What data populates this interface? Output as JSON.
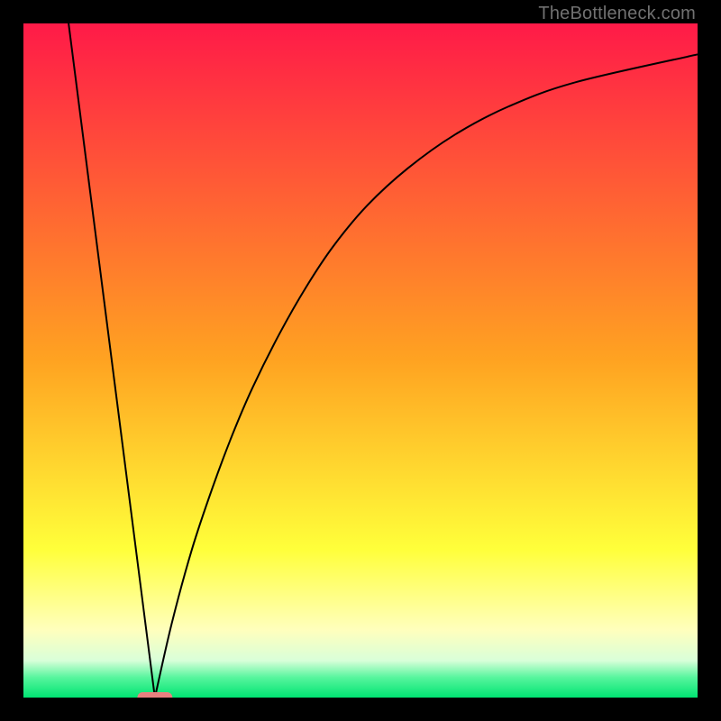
{
  "watermark": "TheBottleneck.com",
  "chart_data": {
    "type": "line",
    "title": "",
    "xlabel": "",
    "ylabel": "",
    "xlim": [
      0,
      100
    ],
    "ylim": [
      0,
      100
    ],
    "grid": false,
    "gradient_stops": [
      {
        "offset": 0.0,
        "color": "#ff1a48"
      },
      {
        "offset": 0.5,
        "color": "#ffa321"
      },
      {
        "offset": 0.78,
        "color": "#ffff3a"
      },
      {
        "offset": 0.9,
        "color": "#ffffbd"
      },
      {
        "offset": 0.945,
        "color": "#d9ffd9"
      },
      {
        "offset": 0.97,
        "color": "#58f59e"
      },
      {
        "offset": 1.0,
        "color": "#00e472"
      }
    ],
    "valley_x": 19.5,
    "series": [
      {
        "name": "left-arm",
        "x": [
          6.7,
          19.5
        ],
        "y": [
          100,
          0
        ]
      },
      {
        "name": "right-arm",
        "x": [
          19.5,
          22,
          25,
          28,
          31,
          34,
          38,
          42,
          46,
          51,
          57,
          64,
          72,
          82,
          100
        ],
        "y": [
          0,
          11,
          22,
          31,
          39,
          46,
          54,
          61,
          67,
          73,
          78.5,
          83.5,
          87.7,
          91.3,
          95.4
        ]
      }
    ],
    "target_marker": {
      "description": "salmon rounded capsule at valley point near x≈19.5, y≈0",
      "cx": 19.5,
      "cy": 0,
      "width_x_units": 5.2,
      "height_y_units": 1.6,
      "color": "#e88080"
    }
  }
}
